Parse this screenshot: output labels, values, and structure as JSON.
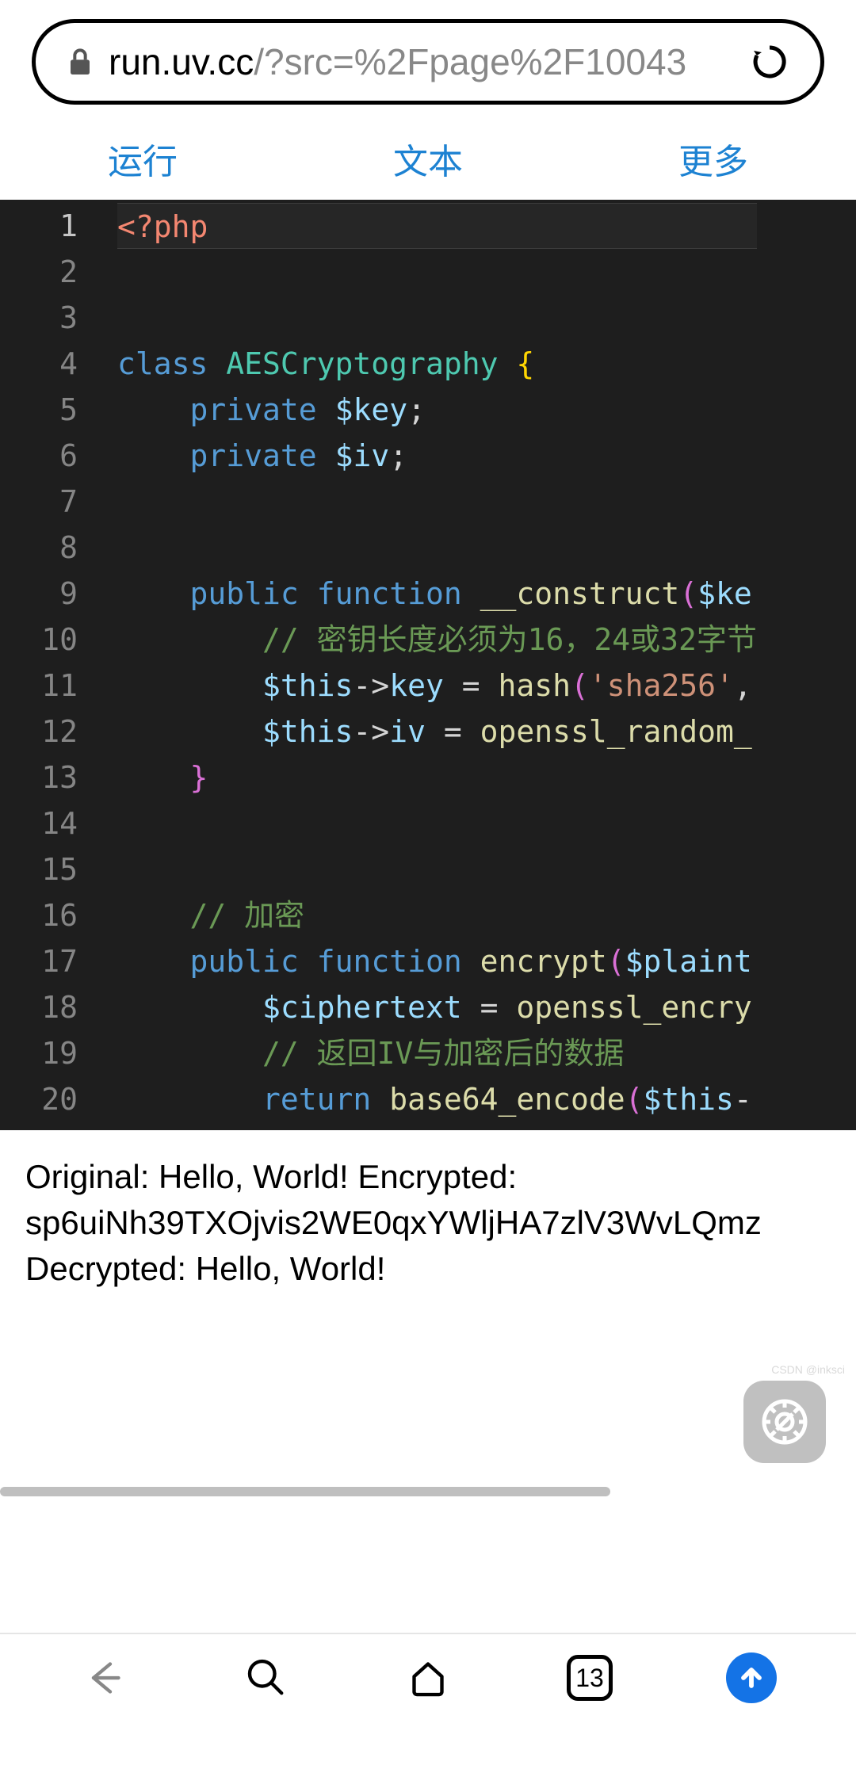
{
  "url": {
    "host": "run.uv.cc",
    "path": "/?src=%2Fpage%2F10043"
  },
  "tabs": {
    "run": "运行",
    "text": "文本",
    "more": "更多"
  },
  "code": {
    "lines": [
      [
        {
          "cls": "tok-open",
          "t": "<?php"
        }
      ],
      [],
      [],
      [
        {
          "cls": "tok-keyword",
          "t": "class"
        },
        {
          "cls": "tok-white",
          "t": " "
        },
        {
          "cls": "tok-class",
          "t": "AESCryptography"
        },
        {
          "cls": "tok-white",
          "t": " "
        },
        {
          "cls": "tok-brace",
          "t": "{"
        }
      ],
      [
        {
          "cls": "indent-guide",
          "t": "    "
        },
        {
          "cls": "tok-keyword",
          "t": "private"
        },
        {
          "cls": "tok-white",
          "t": " "
        },
        {
          "cls": "tok-var",
          "t": "$key"
        },
        {
          "cls": "tok-white",
          "t": ";"
        }
      ],
      [
        {
          "cls": "indent-guide",
          "t": "    "
        },
        {
          "cls": "tok-keyword",
          "t": "private"
        },
        {
          "cls": "tok-white",
          "t": " "
        },
        {
          "cls": "tok-var",
          "t": "$iv"
        },
        {
          "cls": "tok-white",
          "t": ";"
        }
      ],
      [],
      [],
      [
        {
          "cls": "indent-guide",
          "t": "    "
        },
        {
          "cls": "tok-keyword",
          "t": "public"
        },
        {
          "cls": "tok-white",
          "t": " "
        },
        {
          "cls": "tok-keyword",
          "t": "function"
        },
        {
          "cls": "tok-white",
          "t": " "
        },
        {
          "cls": "tok-func",
          "t": "__construct"
        },
        {
          "cls": "tok-brace-pink",
          "t": "("
        },
        {
          "cls": "tok-var",
          "t": "$ke"
        }
      ],
      [
        {
          "cls": "indent-guide",
          "t": "        "
        },
        {
          "cls": "tok-comment",
          "t": "// 密钥长度必须为16，24或32字节"
        }
      ],
      [
        {
          "cls": "indent-guide",
          "t": "        "
        },
        {
          "cls": "tok-var",
          "t": "$this"
        },
        {
          "cls": "tok-white",
          "t": "->"
        },
        {
          "cls": "tok-var",
          "t": "key"
        },
        {
          "cls": "tok-white",
          "t": " = "
        },
        {
          "cls": "tok-func",
          "t": "hash"
        },
        {
          "cls": "tok-brace-pink",
          "t": "("
        },
        {
          "cls": "tok-string",
          "t": "'sha256'"
        },
        {
          "cls": "tok-white",
          "t": ","
        }
      ],
      [
        {
          "cls": "indent-guide",
          "t": "        "
        },
        {
          "cls": "tok-var",
          "t": "$this"
        },
        {
          "cls": "tok-white",
          "t": "->"
        },
        {
          "cls": "tok-var",
          "t": "iv"
        },
        {
          "cls": "tok-white",
          "t": " = "
        },
        {
          "cls": "tok-func",
          "t": "openssl_random_"
        }
      ],
      [
        {
          "cls": "indent-guide",
          "t": "    "
        },
        {
          "cls": "tok-brace-pink",
          "t": "}"
        }
      ],
      [],
      [],
      [
        {
          "cls": "indent-guide",
          "t": "    "
        },
        {
          "cls": "tok-comment",
          "t": "// 加密"
        }
      ],
      [
        {
          "cls": "indent-guide",
          "t": "    "
        },
        {
          "cls": "tok-keyword",
          "t": "public"
        },
        {
          "cls": "tok-white",
          "t": " "
        },
        {
          "cls": "tok-keyword",
          "t": "function"
        },
        {
          "cls": "tok-white",
          "t": " "
        },
        {
          "cls": "tok-func",
          "t": "encrypt"
        },
        {
          "cls": "tok-brace-pink",
          "t": "("
        },
        {
          "cls": "tok-var",
          "t": "$plaint"
        }
      ],
      [
        {
          "cls": "indent-guide",
          "t": "        "
        },
        {
          "cls": "tok-var",
          "t": "$ciphertext"
        },
        {
          "cls": "tok-white",
          "t": " = "
        },
        {
          "cls": "tok-func",
          "t": "openssl_encry"
        }
      ],
      [
        {
          "cls": "indent-guide",
          "t": "        "
        },
        {
          "cls": "tok-comment",
          "t": "// 返回IV与加密后的数据"
        }
      ],
      [
        {
          "cls": "indent-guide",
          "t": "        "
        },
        {
          "cls": "tok-keyword",
          "t": "return"
        },
        {
          "cls": "tok-white",
          "t": " "
        },
        {
          "cls": "tok-func",
          "t": "base64_encode"
        },
        {
          "cls": "tok-brace-pink",
          "t": "("
        },
        {
          "cls": "tok-var",
          "t": "$this"
        },
        {
          "cls": "tok-white",
          "t": "-"
        }
      ]
    ],
    "current_line": 1
  },
  "output": {
    "line1": "Original: Hello, World! Encrypted:",
    "line2": "sp6uiNh39TXOjvis2WE0qxYWljHA7zlV3WvLQmz",
    "line3": "Decrypted: Hello, World!"
  },
  "watermark": "CSDN @inksci",
  "bottom_nav": {
    "tab_count": "13"
  }
}
